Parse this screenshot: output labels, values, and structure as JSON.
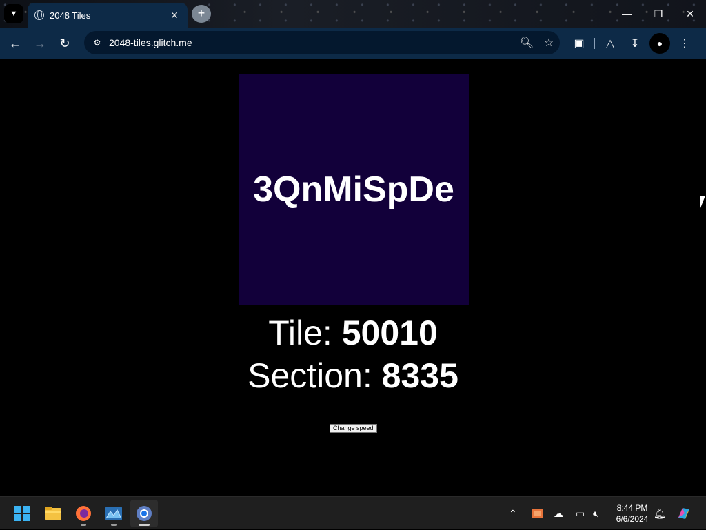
{
  "browser": {
    "tab": {
      "title": "2048 Tiles"
    },
    "address": {
      "url": "2048-tiles.glitch.me"
    }
  },
  "page": {
    "tile_text": "3QnMiSpDe",
    "tile_label": "Tile: ",
    "tile_value": "50010",
    "section_label": "Section: ",
    "section_value": "8335",
    "change_speed_label": "Change speed",
    "tile_color": "#12003a"
  },
  "taskbar": {
    "apps": [
      "windows-start",
      "file-explorer",
      "firefox",
      "photos",
      "chrome"
    ],
    "clock_time": "8:44 PM",
    "clock_date": "6/6/2024"
  },
  "colors": {
    "toolbar": "#0d2a47",
    "omnibox": "#04182e",
    "page_bg": "#000000"
  }
}
